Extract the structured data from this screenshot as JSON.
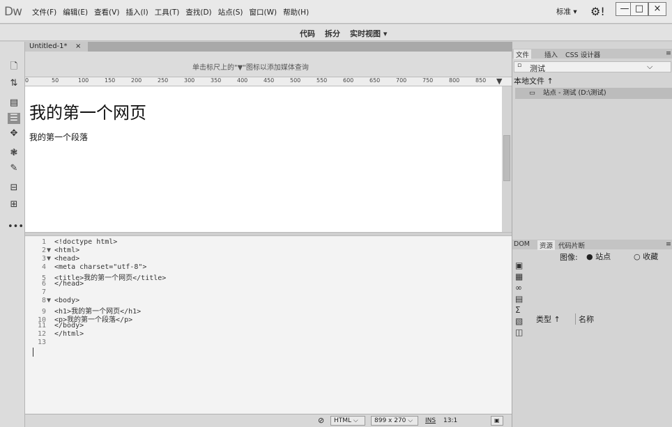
{
  "app": {
    "logo": "Dw"
  },
  "menus": [
    "文件(F)",
    "编辑(E)",
    "查看(V)",
    "插入(I)",
    "工具(T)",
    "查找(D)",
    "站点(S)",
    "窗口(W)",
    "帮助(H)"
  ],
  "workspace": {
    "label": "标准 ▾"
  },
  "window_controls": {
    "minimize": "—",
    "restore": "□",
    "close": "×"
  },
  "view_toolbar": {
    "code": "代码",
    "split": "拆分",
    "live_view": "实时视图 ▾"
  },
  "document": {
    "tab_title": "Untitled-1*",
    "tab_close": "×",
    "info_bar": "单击标尺上的\"▼\"图标以添加媒体查询",
    "ruler_ticks": [
      "0",
      "50",
      "100",
      "150",
      "200",
      "250",
      "300",
      "350",
      "400",
      "450",
      "500",
      "550",
      "600",
      "650",
      "700",
      "750",
      "800",
      "850"
    ],
    "live": {
      "heading": "我的第一个网页",
      "paragraph": "我的第一个段落"
    }
  },
  "code_lines": [
    {
      "num": "1",
      "arrow": "",
      "text": "<!doctype html>"
    },
    {
      "num": "2",
      "arrow": "▼",
      "text": "<html>"
    },
    {
      "num": "3",
      "arrow": "▼",
      "text": "<head>"
    },
    {
      "num": "4",
      "arrow": "",
      "text": "<meta charset=\"utf-8\">"
    },
    {
      "num": "5",
      "arrow": "",
      "text": "<title>我的第一个网页</title>"
    },
    {
      "num": "6",
      "arrow": "",
      "text": "</head>"
    },
    {
      "num": "7",
      "arrow": "",
      "text": ""
    },
    {
      "num": "8",
      "arrow": "▼",
      "text": "<body>"
    },
    {
      "num": "9",
      "arrow": "",
      "text": "<h1>我的第一个网页</h1>"
    },
    {
      "num": "10",
      "arrow": "",
      "text": "<p>我的第一个段落</p>"
    },
    {
      "num": "11",
      "arrow": "",
      "text": "</body>"
    },
    {
      "num": "12",
      "arrow": "",
      "text": "</html>"
    },
    {
      "num": "13",
      "arrow": "",
      "text": ""
    }
  ],
  "status_bar": {
    "language": "HTML",
    "size": "899 x 270",
    "mode": "INS",
    "position": "13:1"
  },
  "files_panel": {
    "tabs": [
      "文件",
      "插入",
      "CSS 设计器"
    ],
    "site": "测试",
    "local_files": "本地文件 ↑",
    "site_row": "站点 - 测试 (D:\\测试)"
  },
  "assets_panel": {
    "tabs": [
      "DOM",
      "资源",
      "代码片断"
    ],
    "images_label": "图像:",
    "radio_site": "站点",
    "radio_fav": "收藏",
    "col_type": "类型 ↑",
    "col_name": "名称"
  },
  "colors": {
    "menubar": "#e9e9e9",
    "panel": "#d4d4d4",
    "code_bg": "#f3f3f3"
  },
  "icons": [
    "new-file-icon",
    "sort-icon",
    "insert-icon",
    "properties-icon",
    "css-icon",
    "behaviors-icon",
    "snippets-icon",
    "assets-icon",
    "files-icon",
    "more-icon",
    "gear-icon"
  ]
}
